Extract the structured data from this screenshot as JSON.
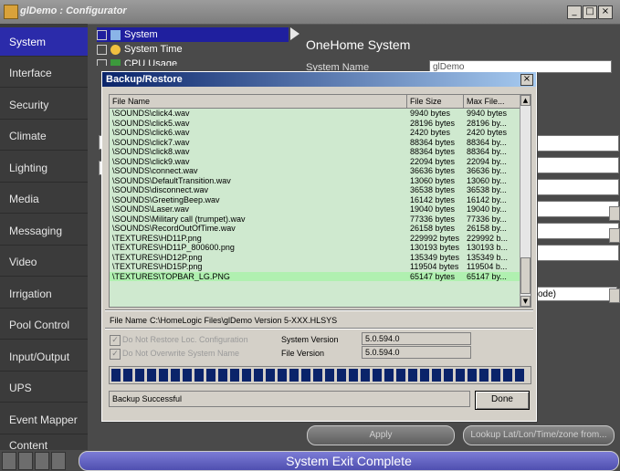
{
  "window": {
    "title": "glDemo : Configurator",
    "buttons": [
      "_",
      "□",
      "×"
    ]
  },
  "sidebar": {
    "items": [
      {
        "label": "System",
        "active": true
      },
      {
        "label": "Interface"
      },
      {
        "label": "Security"
      },
      {
        "label": "Climate"
      },
      {
        "label": "Lighting"
      },
      {
        "label": "Media"
      },
      {
        "label": "Messaging"
      },
      {
        "label": "Video"
      },
      {
        "label": "Irrigation"
      },
      {
        "label": "Pool Control"
      },
      {
        "label": "Input/Output"
      },
      {
        "label": "UPS"
      },
      {
        "label": "Event Mapper"
      },
      {
        "label": "Content"
      }
    ]
  },
  "tree": {
    "items": [
      "System",
      "System Time",
      "CPU Usage"
    ]
  },
  "main": {
    "heading": "OneHome System",
    "field_label": "System Name",
    "field_value": "glDemo",
    "mode_fragment": "ode)"
  },
  "bottom_buttons": {
    "apply": "Apply",
    "lookup": "Lookup Lat/Lon/Time/zone from..."
  },
  "statusbar": {
    "text": "System Exit Complete"
  },
  "dialog": {
    "title": "Backup/Restore",
    "close": "×",
    "columns": [
      "File Name",
      "File Size",
      "Max File..."
    ],
    "scroll_up": "▲",
    "scroll_down": "▼",
    "rows": [
      {
        "name": "\\SOUNDS\\click4.wav",
        "size": "9940 bytes",
        "max": "9940 bytes"
      },
      {
        "name": "\\SOUNDS\\click5.wav",
        "size": "28196 bytes",
        "max": "28196 by..."
      },
      {
        "name": "\\SOUNDS\\click6.wav",
        "size": "2420 bytes",
        "max": "2420 bytes"
      },
      {
        "name": "\\SOUNDS\\click7.wav",
        "size": "88364 bytes",
        "max": "88364 by..."
      },
      {
        "name": "\\SOUNDS\\click8.wav",
        "size": "88364 bytes",
        "max": "88364 by..."
      },
      {
        "name": "\\SOUNDS\\click9.wav",
        "size": "22094 bytes",
        "max": "22094 by..."
      },
      {
        "name": "\\SOUNDS\\connect.wav",
        "size": "36636 bytes",
        "max": "36636 by..."
      },
      {
        "name": "\\SOUNDS\\DefaultTransition.wav",
        "size": "13060 bytes",
        "max": "13060 by..."
      },
      {
        "name": "\\SOUNDS\\disconnect.wav",
        "size": "36538 bytes",
        "max": "36538 by..."
      },
      {
        "name": "\\SOUNDS\\GreetingBeep.wav",
        "size": "16142 bytes",
        "max": "16142 by..."
      },
      {
        "name": "\\SOUNDS\\Laser.wav",
        "size": "19040 bytes",
        "max": "19040 by..."
      },
      {
        "name": "\\SOUNDS\\Military call (trumpet).wav",
        "size": "77336 bytes",
        "max": "77336 by..."
      },
      {
        "name": "\\SOUNDS\\RecordOutOfTime.wav",
        "size": "26158 bytes",
        "max": "26158 by..."
      },
      {
        "name": "\\TEXTURES\\HD11P.png",
        "size": "229992 bytes",
        "max": "229992 b..."
      },
      {
        "name": "\\TEXTURES\\HD11P_800600.png",
        "size": "130193 bytes",
        "max": "130193 b..."
      },
      {
        "name": "\\TEXTURES\\HD12P.png",
        "size": "135349 bytes",
        "max": "135349 b..."
      },
      {
        "name": "\\TEXTURES\\HD15P.png",
        "size": "119504 bytes",
        "max": "119504 b..."
      },
      {
        "name": "\\TEXTURES\\TOPBAR_LG.PNG",
        "size": "65147 bytes",
        "max": "65147 by..."
      }
    ],
    "file_name_label": "File Name",
    "file_name_value": "C:\\HomeLogic Files\\glDemo Version 5-XXX.HLSYS",
    "cb1_label": "Do Not Restore Loc. Configuration",
    "cb2_label": "Do Not Overwrite System Name",
    "cb_mark": "✓",
    "system_version_label": "System Version",
    "system_version_value": "5.0.594.0",
    "file_version_label": "File Version",
    "file_version_value": "5.0.594.0",
    "progress_percent": 100,
    "status": "Backup Successful",
    "done_label": "Done"
  }
}
